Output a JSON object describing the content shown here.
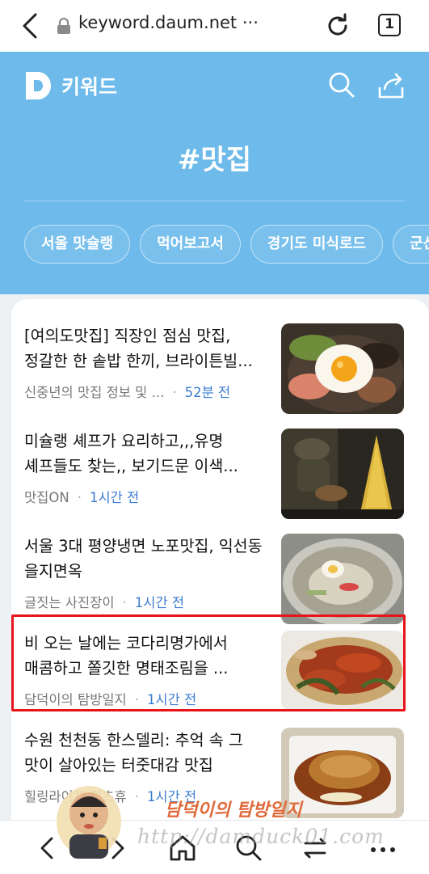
{
  "browser": {
    "url": "keyword.daum.net",
    "more_dots": "···",
    "tab_count": "1"
  },
  "header": {
    "logo_letter": "D",
    "logo_text": "키워드",
    "title": "#맛집",
    "chips": [
      "서울 맛슐랭",
      "먹어보고서",
      "경기도 미식로드",
      "군산"
    ]
  },
  "articles": [
    {
      "title": "[여의도맛집] 직장인 점심 맛집, 정갈한 한 솥밥 한끼, 브라이튼빌...",
      "source": "신중년의 맛집 정보 및 ...",
      "time": "52분 전",
      "thumb": "bibimbap-fried-egg"
    },
    {
      "title": "미슐랭 셰프가 요리하고,,,유명 셰프들도 찾는,, 보기드문 이색...",
      "source": "맛집ON",
      "time": "1시간 전",
      "thumb": "chef-cooking"
    },
    {
      "title": "서울 3대 평양냉면 노포맛집, 익선동 을지면옥",
      "source": "글짓는 사진장이",
      "time": "1시간 전",
      "thumb": "naengmyeon"
    },
    {
      "title": "비 오는 날에는 코다리명가에서 매콤하고 쫄깃한 명태조림을 ...",
      "source": "담덕이의 탐방일지",
      "time": "1시간 전",
      "thumb": "braised-pollack"
    },
    {
      "title": "수원 천천동 한스델리: 추억 속 그 맛이 살아있는 터줏대감 맛집",
      "source": "힐링라이프 인츠휴",
      "time": "1시간 전",
      "thumb": "pork-cutlet"
    }
  ],
  "watermark": {
    "name": "담덕이의 탐방일지",
    "url": "http://damduck01.com"
  },
  "colors": {
    "header_blue": "#6ebbeb",
    "time_blue": "#3b7bd0",
    "highlight_red": "#e8141c"
  }
}
